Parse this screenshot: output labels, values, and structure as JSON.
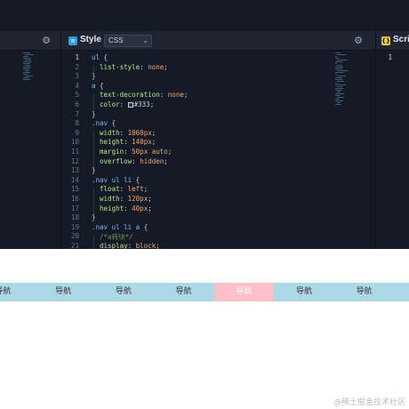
{
  "style_pane": {
    "title": "Style",
    "language": "CSS",
    "icon": "css-badge-icon",
    "active_line": 1,
    "lines": [
      {
        "n": "1",
        "parts": [
          {
            "t": "ul",
            "c": "#79b8ff"
          },
          {
            "t": " {",
            "c": "#c9d1d9"
          }
        ]
      },
      {
        "n": "2",
        "parts": [
          {
            "t": "  list-style",
            "c": "#b5e48c"
          },
          {
            "t": ": ",
            "c": "#c9d1d9"
          },
          {
            "t": "none",
            "c": "#f0a574"
          },
          {
            "t": ";",
            "c": "#c9d1d9"
          }
        ]
      },
      {
        "n": "3",
        "parts": [
          {
            "t": "}",
            "c": "#c9d1d9"
          }
        ]
      },
      {
        "n": "4",
        "parts": [
          {
            "t": "a",
            "c": "#79b8ff"
          },
          {
            "t": " {",
            "c": "#c9d1d9"
          }
        ]
      },
      {
        "n": "5",
        "parts": [
          {
            "t": "  text-decoration",
            "c": "#b5e48c"
          },
          {
            "t": ": ",
            "c": "#c9d1d9"
          },
          {
            "t": "none",
            "c": "#f0a574"
          },
          {
            "t": ";",
            "c": "#c9d1d9"
          }
        ]
      },
      {
        "n": "6",
        "swatch": true,
        "parts": [
          {
            "t": "  color",
            "c": "#b5e48c"
          },
          {
            "t": ": ",
            "c": "#c9d1d9"
          },
          {
            "t": "#333",
            "c": "#c9d1d9"
          },
          {
            "t": ";",
            "c": "#c9d1d9"
          }
        ]
      },
      {
        "n": "7",
        "parts": [
          {
            "t": "}",
            "c": "#c9d1d9"
          }
        ]
      },
      {
        "n": "8",
        "parts": [
          {
            "t": ".nav",
            "c": "#79b8ff"
          },
          {
            "t": " {",
            "c": "#c9d1d9"
          }
        ]
      },
      {
        "n": "9",
        "parts": [
          {
            "t": "  width",
            "c": "#b5e48c"
          },
          {
            "t": ": ",
            "c": "#c9d1d9"
          },
          {
            "t": "1060px",
            "c": "#f0a574"
          },
          {
            "t": ";",
            "c": "#c9d1d9"
          }
        ]
      },
      {
        "n": "10",
        "parts": [
          {
            "t": "  height",
            "c": "#b5e48c"
          },
          {
            "t": ": ",
            "c": "#c9d1d9"
          },
          {
            "t": "140px",
            "c": "#f0a574"
          },
          {
            "t": ";",
            "c": "#c9d1d9"
          }
        ]
      },
      {
        "n": "11",
        "parts": [
          {
            "t": "  margin",
            "c": "#b5e48c"
          },
          {
            "t": ": ",
            "c": "#c9d1d9"
          },
          {
            "t": "50px auto",
            "c": "#f0a574"
          },
          {
            "t": ";",
            "c": "#c9d1d9"
          }
        ]
      },
      {
        "n": "12",
        "parts": [
          {
            "t": "  overflow",
            "c": "#b5e48c"
          },
          {
            "t": ": ",
            "c": "#c9d1d9"
          },
          {
            "t": "hidden",
            "c": "#f0a574"
          },
          {
            "t": ";",
            "c": "#c9d1d9"
          }
        ]
      },
      {
        "n": "13",
        "parts": [
          {
            "t": "}",
            "c": "#c9d1d9"
          }
        ]
      },
      {
        "n": "14",
        "parts": [
          {
            "t": ".nav ul li",
            "c": "#79b8ff"
          },
          {
            "t": " {",
            "c": "#c9d1d9"
          }
        ]
      },
      {
        "n": "15",
        "parts": [
          {
            "t": "  float",
            "c": "#b5e48c"
          },
          {
            "t": ": ",
            "c": "#c9d1d9"
          },
          {
            "t": "left",
            "c": "#f0a574"
          },
          {
            "t": ";",
            "c": "#c9d1d9"
          }
        ]
      },
      {
        "n": "16",
        "parts": [
          {
            "t": "  width",
            "c": "#b5e48c"
          },
          {
            "t": ": ",
            "c": "#c9d1d9"
          },
          {
            "t": "120px",
            "c": "#f0a574"
          },
          {
            "t": ";",
            "c": "#c9d1d9"
          }
        ]
      },
      {
        "n": "17",
        "parts": [
          {
            "t": "  height",
            "c": "#b5e48c"
          },
          {
            "t": ": ",
            "c": "#c9d1d9"
          },
          {
            "t": "40px",
            "c": "#f0a574"
          },
          {
            "t": ";",
            "c": "#c9d1d9"
          }
        ]
      },
      {
        "n": "18",
        "parts": [
          {
            "t": "}",
            "c": "#c9d1d9"
          }
        ]
      },
      {
        "n": "19",
        "parts": [
          {
            "t": ".nav ul li a",
            "c": "#79b8ff"
          },
          {
            "t": " {",
            "c": "#c9d1d9"
          }
        ]
      },
      {
        "n": "20",
        "parts": [
          {
            "t": "  /*a转块*/",
            "c": "#6a9955"
          }
        ]
      },
      {
        "n": "21",
        "parts": [
          {
            "t": "  display",
            "c": "#b5e48c"
          },
          {
            "t": ": ",
            "c": "#c9d1d9"
          },
          {
            "t": "block",
            "c": "#f0a574"
          },
          {
            "t": ";",
            "c": "#c9d1d9"
          }
        ]
      }
    ]
  },
  "script_pane": {
    "title": "Script",
    "icon": "js-badge-icon",
    "lines": [
      "1"
    ]
  },
  "preview": {
    "nav_items": [
      "导航",
      "导航",
      "导航",
      "导航",
      "导航",
      "导航",
      "导航"
    ],
    "active_index": 4,
    "nav_bg": "#add8e6",
    "active_bg": "#ffc0cb"
  },
  "watermark": "@稀土掘金技术社区"
}
